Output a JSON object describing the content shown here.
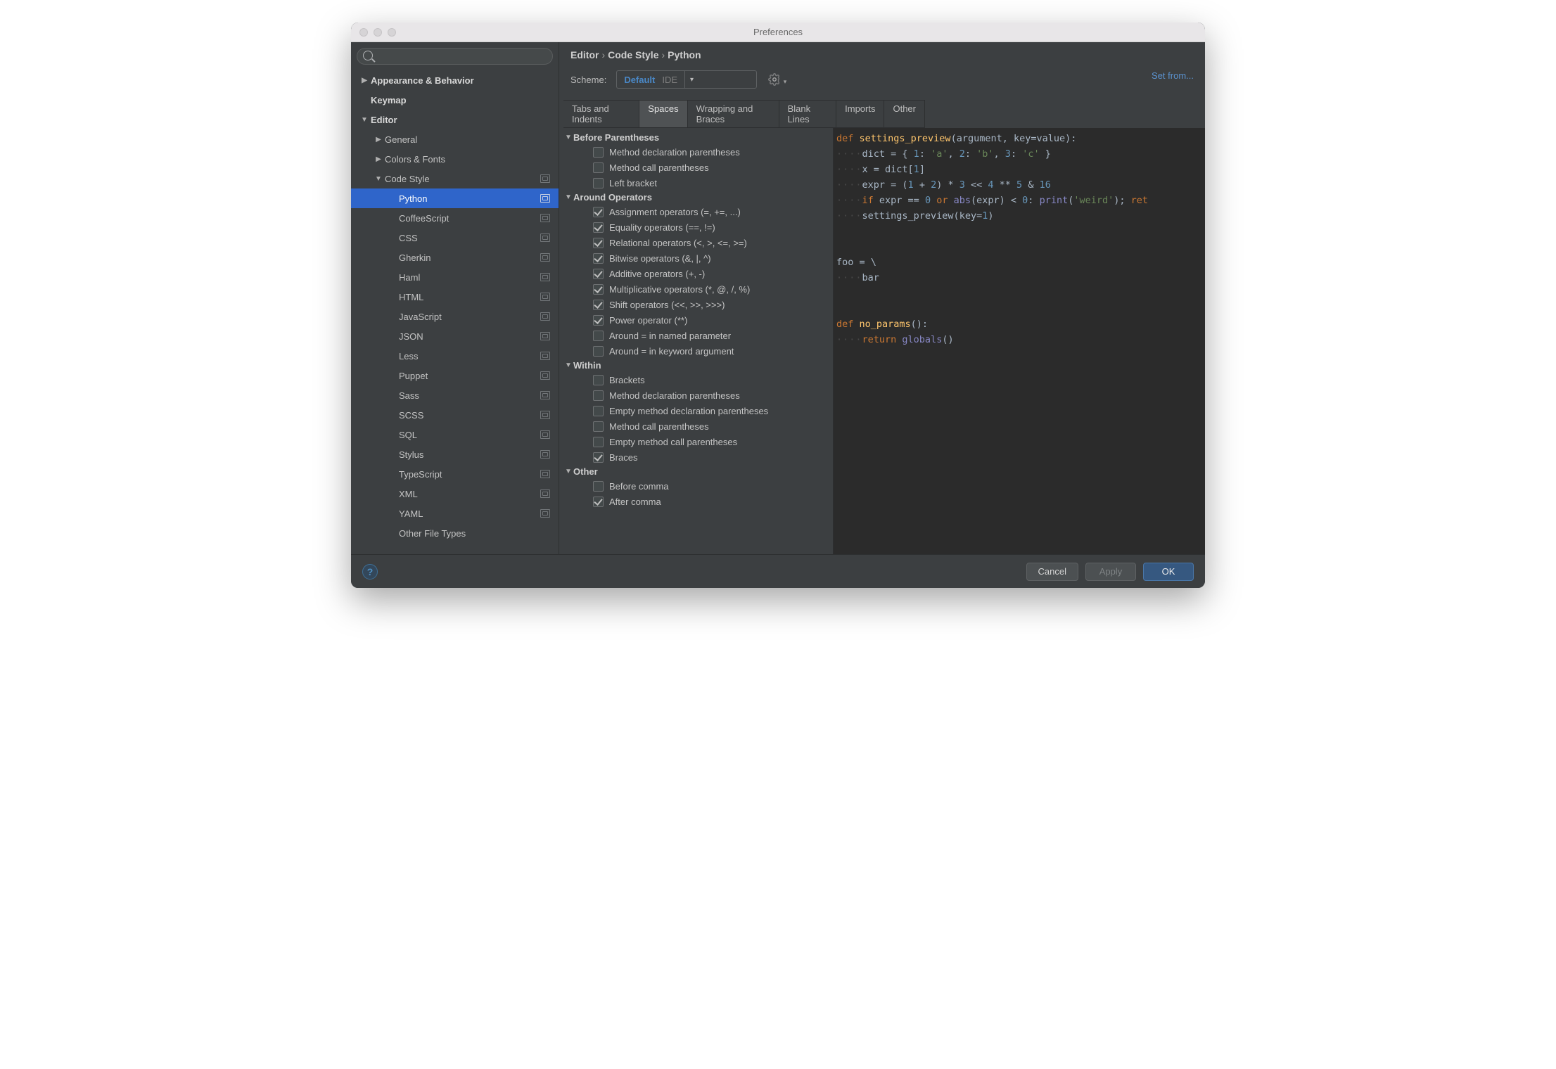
{
  "window_title": "Preferences",
  "sidebar": {
    "tree": [
      {
        "label": "Appearance & Behavior",
        "depth": 0,
        "arrow": "right",
        "bold": true
      },
      {
        "label": "Keymap",
        "depth": 0,
        "arrow": "",
        "bold": true
      },
      {
        "label": "Editor",
        "depth": 0,
        "arrow": "down",
        "bold": true
      },
      {
        "label": "General",
        "depth": 1,
        "arrow": "right",
        "bold": false
      },
      {
        "label": "Colors & Fonts",
        "depth": 1,
        "arrow": "right",
        "bold": false
      },
      {
        "label": "Code Style",
        "depth": 1,
        "arrow": "down",
        "bold": false,
        "schemeIcon": true
      },
      {
        "label": "Python",
        "depth": 2,
        "arrow": "",
        "bold": false,
        "selected": true,
        "schemeIcon": true
      },
      {
        "label": "CoffeeScript",
        "depth": 2,
        "arrow": "",
        "bold": false,
        "schemeIcon": true
      },
      {
        "label": "CSS",
        "depth": 2,
        "arrow": "",
        "bold": false,
        "schemeIcon": true
      },
      {
        "label": "Gherkin",
        "depth": 2,
        "arrow": "",
        "bold": false,
        "schemeIcon": true
      },
      {
        "label": "Haml",
        "depth": 2,
        "arrow": "",
        "bold": false,
        "schemeIcon": true
      },
      {
        "label": "HTML",
        "depth": 2,
        "arrow": "",
        "bold": false,
        "schemeIcon": true
      },
      {
        "label": "JavaScript",
        "depth": 2,
        "arrow": "",
        "bold": false,
        "schemeIcon": true
      },
      {
        "label": "JSON",
        "depth": 2,
        "arrow": "",
        "bold": false,
        "schemeIcon": true
      },
      {
        "label": "Less",
        "depth": 2,
        "arrow": "",
        "bold": false,
        "schemeIcon": true
      },
      {
        "label": "Puppet",
        "depth": 2,
        "arrow": "",
        "bold": false,
        "schemeIcon": true
      },
      {
        "label": "Sass",
        "depth": 2,
        "arrow": "",
        "bold": false,
        "schemeIcon": true
      },
      {
        "label": "SCSS",
        "depth": 2,
        "arrow": "",
        "bold": false,
        "schemeIcon": true
      },
      {
        "label": "SQL",
        "depth": 2,
        "arrow": "",
        "bold": false,
        "schemeIcon": true
      },
      {
        "label": "Stylus",
        "depth": 2,
        "arrow": "",
        "bold": false,
        "schemeIcon": true
      },
      {
        "label": "TypeScript",
        "depth": 2,
        "arrow": "",
        "bold": false,
        "schemeIcon": true
      },
      {
        "label": "XML",
        "depth": 2,
        "arrow": "",
        "bold": false,
        "schemeIcon": true
      },
      {
        "label": "YAML",
        "depth": 2,
        "arrow": "",
        "bold": false,
        "schemeIcon": true
      },
      {
        "label": "Other File Types",
        "depth": 2,
        "arrow": "",
        "bold": false
      }
    ]
  },
  "breadcrumbs": [
    "Editor",
    "Code Style",
    "Python"
  ],
  "scheme": {
    "label": "Scheme:",
    "value": "Default",
    "badge": "IDE"
  },
  "set_from": "Set from...",
  "tabs": [
    "Tabs and Indents",
    "Spaces",
    "Wrapping and Braces",
    "Blank Lines",
    "Imports",
    "Other"
  ],
  "active_tab": 1,
  "groups": [
    {
      "title": "Before Parentheses",
      "options": [
        {
          "label": "Method declaration parentheses",
          "checked": false
        },
        {
          "label": "Method call parentheses",
          "checked": false
        },
        {
          "label": "Left bracket",
          "checked": false
        }
      ]
    },
    {
      "title": "Around Operators",
      "options": [
        {
          "label": "Assignment operators (=, +=, ...)",
          "checked": true
        },
        {
          "label": "Equality operators (==, !=)",
          "checked": true
        },
        {
          "label": "Relational operators (<, >, <=, >=)",
          "checked": true
        },
        {
          "label": "Bitwise operators (&, |, ^)",
          "checked": true
        },
        {
          "label": "Additive operators (+, -)",
          "checked": true
        },
        {
          "label": "Multiplicative operators (*, @, /, %)",
          "checked": true
        },
        {
          "label": "Shift operators (<<, >>, >>>)",
          "checked": true
        },
        {
          "label": "Power operator (**)",
          "checked": true
        },
        {
          "label": "Around = in named parameter",
          "checked": false
        },
        {
          "label": "Around = in keyword argument",
          "checked": false
        }
      ]
    },
    {
      "title": "Within",
      "options": [
        {
          "label": "Brackets",
          "checked": false
        },
        {
          "label": "Method declaration parentheses",
          "checked": false
        },
        {
          "label": "Empty method declaration parentheses",
          "checked": false
        },
        {
          "label": "Method call parentheses",
          "checked": false
        },
        {
          "label": "Empty method call parentheses",
          "checked": false
        },
        {
          "label": "Braces",
          "checked": true
        }
      ]
    },
    {
      "title": "Other",
      "options": [
        {
          "label": "Before comma",
          "checked": false
        },
        {
          "label": "After comma",
          "checked": true
        }
      ]
    }
  ],
  "code_preview": {
    "tokens": [
      [
        [
          "kw",
          "def "
        ],
        [
          "fn",
          "settings_preview"
        ],
        [
          "par",
          "(argument"
        ],
        [
          "nm",
          ", "
        ],
        [
          "par",
          "key"
        ],
        [
          "nm",
          "="
        ],
        [
          "nm",
          "value):"
        ]
      ],
      [
        [
          "dotline",
          "····"
        ],
        [
          "nm",
          "dict = { "
        ],
        [
          "num",
          "1"
        ],
        [
          "nm",
          ": "
        ],
        [
          "str",
          "'a'"
        ],
        [
          "nm",
          ", "
        ],
        [
          "num",
          "2"
        ],
        [
          "nm",
          ": "
        ],
        [
          "str",
          "'b'"
        ],
        [
          "nm",
          ", "
        ],
        [
          "num",
          "3"
        ],
        [
          "nm",
          ": "
        ],
        [
          "str",
          "'c'"
        ],
        [
          "nm",
          " }"
        ]
      ],
      [
        [
          "dotline",
          "····"
        ],
        [
          "nm",
          "x = dict["
        ],
        [
          "num",
          "1"
        ],
        [
          "nm",
          "]"
        ]
      ],
      [
        [
          "dotline",
          "····"
        ],
        [
          "nm",
          "expr = ("
        ],
        [
          "num",
          "1"
        ],
        [
          "nm",
          " + "
        ],
        [
          "num",
          "2"
        ],
        [
          "nm",
          ") * "
        ],
        [
          "num",
          "3"
        ],
        [
          "nm",
          " << "
        ],
        [
          "num",
          "4"
        ],
        [
          "nm",
          " ** "
        ],
        [
          "num",
          "5"
        ],
        [
          "nm",
          " & "
        ],
        [
          "num",
          "16"
        ]
      ],
      [
        [
          "dotline",
          "····"
        ],
        [
          "kw",
          "if "
        ],
        [
          "nm",
          "expr == "
        ],
        [
          "num",
          "0"
        ],
        [
          "nm",
          " "
        ],
        [
          "kw",
          "or "
        ],
        [
          "builtin",
          "abs"
        ],
        [
          "nm",
          "(expr) < "
        ],
        [
          "num",
          "0"
        ],
        [
          "nm",
          ": "
        ],
        [
          "builtin",
          "print"
        ],
        [
          "nm",
          "("
        ],
        [
          "str",
          "'weird'"
        ],
        [
          "nm",
          "); "
        ],
        [
          "kw",
          "ret"
        ]
      ],
      [
        [
          "dotline",
          "····"
        ],
        [
          "nm",
          "settings_preview("
        ],
        [
          "par",
          "key"
        ],
        [
          "nm",
          "="
        ],
        [
          "num",
          "1"
        ],
        [
          "nm",
          ")"
        ]
      ],
      [
        [
          "nm",
          ""
        ]
      ],
      [
        [
          "nm",
          ""
        ]
      ],
      [
        [
          "nm",
          "foo = \\"
        ]
      ],
      [
        [
          "dotline",
          "····"
        ],
        [
          "nm",
          "bar"
        ]
      ],
      [
        [
          "nm",
          ""
        ]
      ],
      [
        [
          "nm",
          ""
        ]
      ],
      [
        [
          "kw",
          "def "
        ],
        [
          "fn",
          "no_params"
        ],
        [
          "nm",
          "():"
        ]
      ],
      [
        [
          "dotline",
          "····"
        ],
        [
          "kw",
          "return "
        ],
        [
          "builtin",
          "globals"
        ],
        [
          "nm",
          "()"
        ]
      ]
    ]
  },
  "footer": {
    "cancel": "Cancel",
    "apply": "Apply",
    "ok": "OK"
  }
}
